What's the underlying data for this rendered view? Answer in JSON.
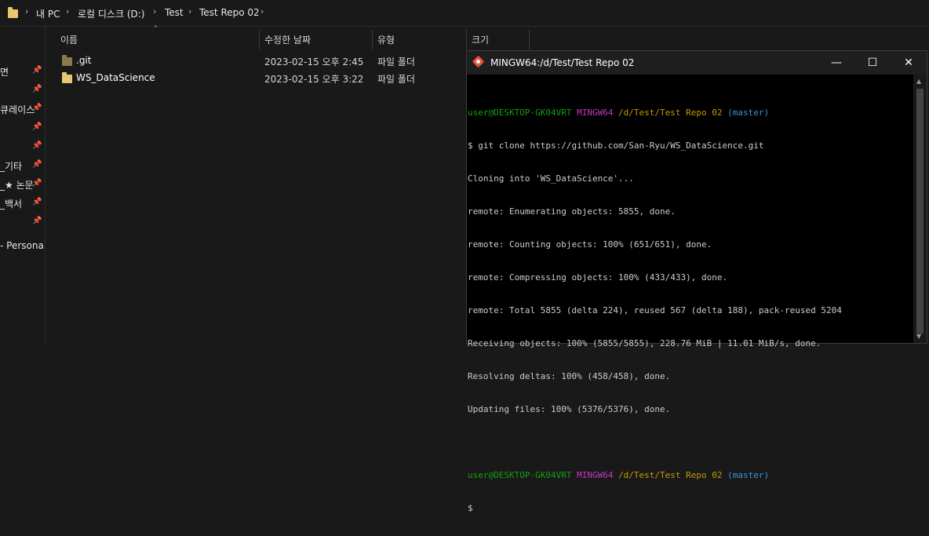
{
  "address_bar": {
    "crumbs": [
      "내 PC",
      "로컬 디스크 (D:)",
      "Test",
      "Test Repo 02"
    ]
  },
  "nav_pane": {
    "items": [
      {
        "label": "면",
        "pinned": true
      },
      {
        "label": "",
        "pinned": true
      },
      {
        "label": "큐레이스",
        "pinned": true
      },
      {
        "label": "",
        "pinned": true
      },
      {
        "label": "",
        "pinned": true
      },
      {
        "label": "_기타",
        "pinned": true
      },
      {
        "label": "_★ 논문",
        "pinned": true
      },
      {
        "label": "_백서",
        "pinned": true
      },
      {
        "label": "",
        "pinned": true
      }
    ],
    "personal": "- Personal"
  },
  "columns": {
    "name": "이름",
    "date": "수정한 날짜",
    "type": "유형",
    "size": "크기"
  },
  "files": [
    {
      "name": ".git",
      "date": "2023-02-15 오후 2:45",
      "type": "파일 폴더",
      "icon": "git-folder-icon"
    },
    {
      "name": "WS_DataScience",
      "date": "2023-02-15 오후 3:22",
      "type": "파일 폴더",
      "icon": "folder-icon"
    }
  ],
  "terminal": {
    "title": "MINGW64:/d/Test/Test Repo 02",
    "buttons": {
      "minimize": "—",
      "maximize": "☐",
      "close": "✕"
    },
    "prompt1": {
      "user": "user@DESKTOP-GK04VRT",
      "shell": "MINGW64",
      "path": "/d/Test/Test Repo 02",
      "branch": "(master)"
    },
    "command": "$ git clone https://github.com/San-Ryu/WS_DataScience.git",
    "output": [
      "Cloning into 'WS_DataScience'...",
      "remote: Enumerating objects: 5855, done.",
      "remote: Counting objects: 100% (651/651), done.",
      "remote: Compressing objects: 100% (433/433), done.",
      "remote: Total 5855 (delta 224), reused 567 (delta 188), pack-reused 5204",
      "Receiving objects: 100% (5855/5855), 228.76 MiB | 11.01 MiB/s, done.",
      "Resolving deltas: 100% (458/458), done.",
      "Updating files: 100% (5376/5376), done."
    ],
    "prompt2": {
      "user": "user@DESKTOP-GK04VRT",
      "shell": "MINGW64",
      "path": "/d/Test/Test Repo 02",
      "branch": "(master)"
    },
    "cursor": "$"
  }
}
